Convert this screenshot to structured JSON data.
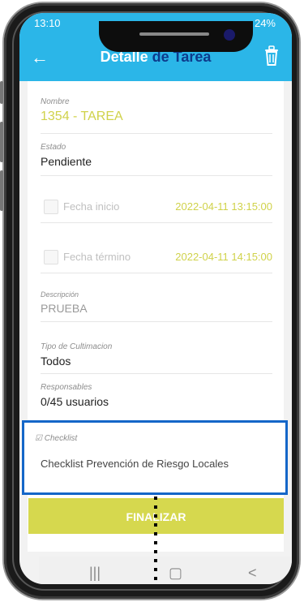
{
  "status": {
    "time": "13:10",
    "battery": "24%"
  },
  "header": {
    "title_part1": "Detalle",
    "title_part2": "de Tarea"
  },
  "fields": {
    "nombre": {
      "label": "Nombre",
      "value": "1354 - TAREA"
    },
    "estado": {
      "label": "Estado",
      "value": "Pendiente"
    },
    "fecha_inicio": {
      "label": "Fecha inicio",
      "value": "2022-04-11 13:15:00"
    },
    "fecha_termino": {
      "label": "Fecha término",
      "value": "2022-04-11 14:15:00"
    },
    "descripcion": {
      "label": "Descripción",
      "value": "PRUEBA"
    },
    "tipo": {
      "label": "Tipo de Cultimacion",
      "value": "Todos"
    },
    "responsables": {
      "label": "Responsables",
      "value": "0/45 usuarios"
    }
  },
  "checklist": {
    "label": "Checklist",
    "value": "Checklist Prevención de Riesgo Locales"
  },
  "actions": {
    "finalizar": "FINALIZAR"
  },
  "navbar": {
    "recents": "|||",
    "home": "▢",
    "back": "<"
  },
  "colors": {
    "primary": "#2bb6e8",
    "accent_yellow": "#d6d84e",
    "highlight_border": "#1466c8",
    "title_dark": "#0d3b8c"
  }
}
